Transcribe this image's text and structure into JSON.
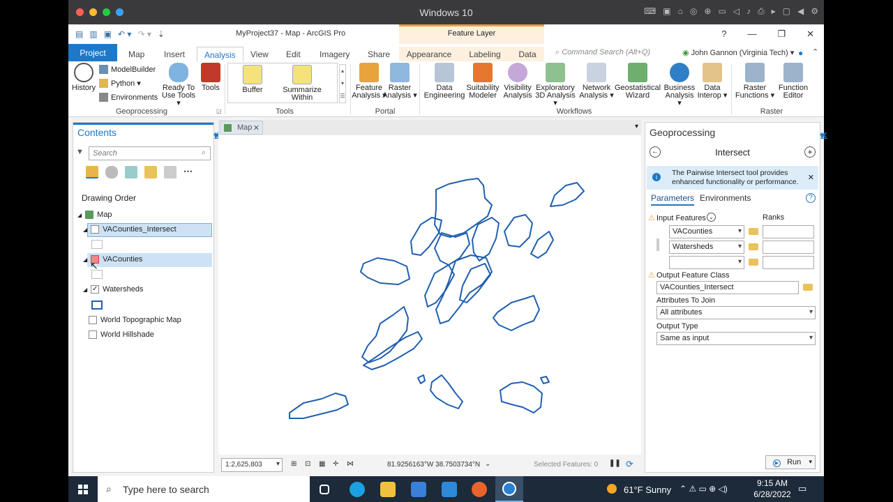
{
  "os": {
    "title": "Windows 10",
    "colors": {
      "close": "#ff5f57",
      "min": "#febc2e",
      "max": "#28c840",
      "fs": "#3aa0f3"
    }
  },
  "app": {
    "title": "MyProject37 - Map - ArcGIS Pro",
    "context_tab": "Feature Layer",
    "help": "?",
    "window_controls": [
      "—",
      "❐",
      "✕"
    ]
  },
  "tabs": [
    "Project",
    "Map",
    "Insert",
    "Analysis",
    "View",
    "Edit",
    "Imagery",
    "Share",
    "Appearance",
    "Labeling",
    "Data"
  ],
  "command_search": "Command Search (Alt+Q)",
  "user": "John Gannon (Virginia Tech) ▾",
  "ribbon": {
    "geoprocessing": {
      "history": "History",
      "modelbuilder": "ModelBuilder",
      "python": "Python ▾",
      "environments": "Environments",
      "ready_to_use_1": "Ready To",
      "ready_to_use_2": "Use Tools ▾",
      "tools": "Tools",
      "label": "Geoprocessing"
    },
    "tools": {
      "buffer": "Buffer",
      "summarize_1": "Summarize",
      "summarize_2": "Within",
      "label": "Tools"
    },
    "portal": {
      "feature_1": "Feature",
      "feature_2": "Analysis ▾",
      "raster_1": "Raster",
      "raster_2": "Analysis ▾",
      "label": "Portal"
    },
    "workflows": {
      "items": [
        [
          "Data",
          "Engineering"
        ],
        [
          "Suitability",
          "Modeler"
        ],
        [
          "Visibility",
          "Analysis"
        ],
        [
          "Exploratory",
          "3D Analysis ▾"
        ],
        [
          "Network",
          "Analysis ▾"
        ],
        [
          "Geostatistical",
          "Wizard"
        ],
        [
          "Business",
          "Analysis ▾"
        ],
        [
          "Data",
          "Interop ▾"
        ]
      ],
      "label": "Workflows"
    },
    "raster": {
      "items": [
        [
          "Raster",
          "Functions ▾"
        ],
        [
          "Function",
          "Editor"
        ]
      ],
      "label": "Raster"
    }
  },
  "contents": {
    "title": "Contents",
    "search_placeholder": "Search",
    "section": "Drawing Order",
    "map": "Map",
    "layers": [
      "VACounties_Intersect",
      "VACounties",
      "Watersheds",
      "World Topographic Map",
      "World Hillshade"
    ]
  },
  "map_view": {
    "tab": "Map",
    "scale": "1:2,625,803",
    "coords": "81.9256163°W 38.7503734°N",
    "selected": "Selected Features: 0"
  },
  "geoprocessing": {
    "title": "Geoprocessing",
    "tool": "Intersect",
    "info": "The Pairwise Intersect tool provides enhanced functionality or performance.",
    "info_link": "Pairwise Intersect",
    "tabs": [
      "Parameters",
      "Environments"
    ],
    "input_features_label": "Input Features",
    "ranks_label": "Ranks",
    "inputs": [
      "VACounties",
      "Watersheds",
      ""
    ],
    "output_label": "Output Feature Class",
    "output_value": "VACounties_Intersect",
    "attributes_label": "Attributes To Join",
    "attributes_value": "All attributes",
    "output_type_label": "Output Type",
    "output_type_value": "Same as input",
    "run": "Run"
  },
  "taskbar": {
    "search": "Type here to search",
    "weather": "61°F  Sunny",
    "time": "9:15 AM",
    "date": "6/28/2022"
  }
}
